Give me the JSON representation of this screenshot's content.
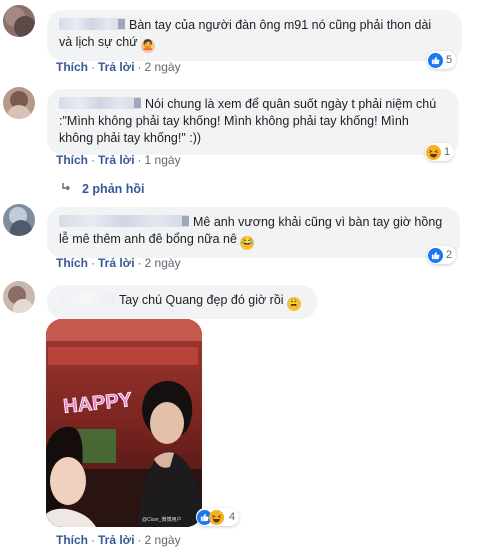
{
  "comments": [
    {
      "text": "Bàn tay của người đàn ông m91 nó cũng phải thon dài và lịch sự chứ",
      "text_line1": "Bàn tay của người đàn ông m91 nó cũng phải thon dài",
      "text_line2": "và lịch sự chứ",
      "trailing_emoji": "person-gesturing-icon",
      "like_label": "Thích",
      "reply_label": "Trả lời",
      "time": "2 ngày",
      "reaction_count": "5",
      "reaction_type": "like"
    },
    {
      "text_line1": "Nói chung là xem để quân suốt ngày t phải niệm chú",
      "text_line2": ":\"Mình không phải tay khống! Mình không phải tay khống! Mình",
      "text_line3": "không phải tay khống!\" :))",
      "like_label": "Thích",
      "reply_label": "Trả lời",
      "time": "1 ngày",
      "reaction_count": "1",
      "reaction_type": "haha"
    },
    {
      "text_line1": "Mê anh vương khải cũng vì bàn tay giờ hồng",
      "text_line2": "lễ mê thêm anh đê bổng nữa nê",
      "trailing_emoji": "laughing-icon",
      "like_label": "Thích",
      "reply_label": "Trả lời",
      "time": "2 ngày",
      "reaction_count": "2",
      "reaction_type": "like"
    },
    {
      "text_line1": "Tay chú Quang đẹp đó giờ rồi",
      "trailing_emoji": "tired-face-icon",
      "like_label": "Thích",
      "reply_label": "Trả lời",
      "time": "2 ngày",
      "reaction_count": "4",
      "reaction_type": "like-haha"
    }
  ],
  "replies_link": {
    "label": "2 phản hồi",
    "icon": "reply-arrow-icon"
  },
  "photo": {
    "banner_text": "HAPPY",
    "watermark": "@Cicer_微博用户"
  },
  "colors": {
    "link": "#385898",
    "bubble": "#f2f3f5",
    "like": "#1877f2",
    "haha": "#f7b125",
    "meta": "#606770"
  }
}
